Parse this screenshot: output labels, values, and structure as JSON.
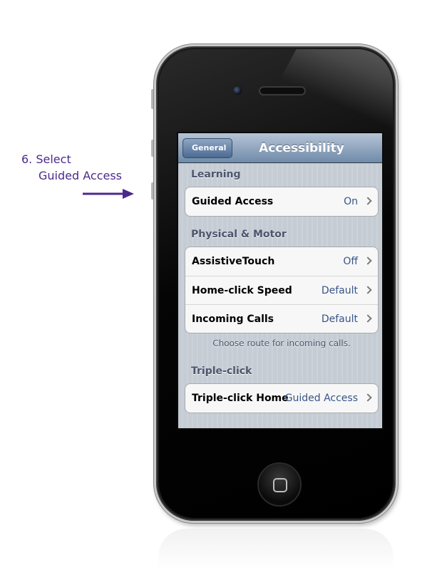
{
  "annotation": {
    "line1": "6. Select",
    "line2": "Guided Access",
    "color": "#4b2a8c"
  },
  "screen": {
    "nav": {
      "back_label": "General",
      "title": "Accessibility"
    },
    "sections": [
      {
        "header": "Learning",
        "rows": [
          {
            "label": "Guided Access",
            "value": "On"
          }
        ]
      },
      {
        "header": "Physical & Motor",
        "rows": [
          {
            "label": "AssistiveTouch",
            "value": "Off"
          },
          {
            "label": "Home-click Speed",
            "value": "Default"
          },
          {
            "label": "Incoming Calls",
            "value": "Default"
          }
        ],
        "footer": "Choose route for incoming calls."
      },
      {
        "header": "Triple-click",
        "rows": [
          {
            "label": "Triple-click Home",
            "value": "Guided Access"
          }
        ]
      }
    ]
  },
  "icons": {
    "chevron": "chevron-right-icon",
    "arrow": "arrow-right-icon",
    "home": "home-button-icon"
  },
  "colors": {
    "value_text": "#385487",
    "section_header": "#4c566c",
    "nav_top": "#b6c4d6",
    "nav_bottom": "#6f8ba9"
  }
}
